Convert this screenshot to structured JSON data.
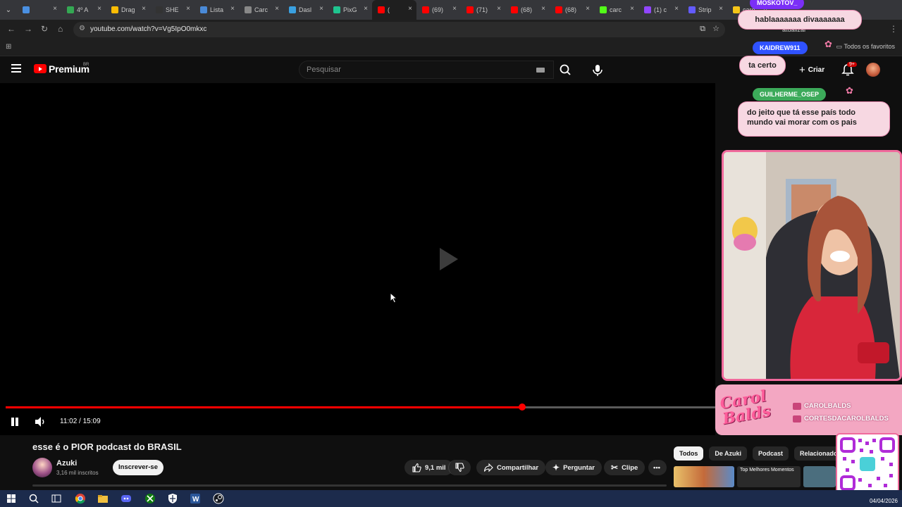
{
  "browser": {
    "tabs": [
      {
        "label": "",
        "color": "#4a90e2"
      },
      {
        "label": "4º A",
        "color": "#34a853"
      },
      {
        "label": "Drag",
        "color": "#fbbc04"
      },
      {
        "label": "SHE",
        "color": "#333333"
      },
      {
        "label": "Lista",
        "color": "#4a8ad8"
      },
      {
        "label": "Carc",
        "color": "#888888"
      },
      {
        "label": "Dasl",
        "color": "#3aa0e0"
      },
      {
        "label": "PixG",
        "color": "#1fc48f"
      },
      {
        "label": "(",
        "color": "#ff0000"
      },
      {
        "label": "(69)",
        "color": "#ff0000"
      },
      {
        "label": "(71)",
        "color": "#ff0000"
      },
      {
        "label": "(68)",
        "color": "#ff0000"
      },
      {
        "label": "(68)",
        "color": "#ff0000"
      },
      {
        "label": "carc",
        "color": "#53fc18"
      },
      {
        "label": "(1) c",
        "color": "#9146ff"
      },
      {
        "label": "Strip",
        "color": "#635bff"
      },
      {
        "label": "caro",
        "color": "#f5c518"
      }
    ],
    "active_tab_index": 8,
    "url": "youtube.com/watch?v=Vg5IpO0mkxc",
    "update_label": "atualizar",
    "bookmarks_all": "Todos os favoritos"
  },
  "youtube": {
    "brand": "Premium",
    "region": "BR",
    "search_placeholder": "Pesquisar",
    "create_label": "Criar",
    "notif_count": "9+",
    "colors": {
      "red": "#ff0000",
      "bg": "#0f0f0f"
    }
  },
  "player": {
    "time": "11:02 / 15:09",
    "progress": 0.728
  },
  "video": {
    "title": "esse é o PIOR podcast do BRASIL",
    "channel": "Azuki",
    "subscribers": "3,16 mil inscritos",
    "subscribe_label": "Inscrever-se",
    "likes": "9,1 mil",
    "share_label": "Compartilhar",
    "ask_label": "Perguntar",
    "clip_label": "Clipe"
  },
  "chips": [
    "Todos",
    "De Azuki",
    "Podcast",
    "Relacionados"
  ],
  "recommended": {
    "thumb_text": "Top Melhores Momentos"
  },
  "stream_overlay": {
    "chat": [
      {
        "user": "MOSKOTOV_",
        "message": "hablaaaaaaa divaaaaaaa",
        "name_color": "#7b2ff7"
      },
      {
        "user": "KAIDREW911",
        "message": "ta certo",
        "name_color": "#2f52ff"
      },
      {
        "user": "GUILHERME_OSEP",
        "message": "do jeito que tá esse país todo mundo vai morar com os pais",
        "name_color": "#3caa5a"
      }
    ],
    "brand_name": "Carol Balds",
    "social_1": "CAROLBALDS",
    "social_2": "CORTESDACAROLBALDS"
  },
  "taskbar": {
    "date": "04/04/2026",
    "apps": [
      "windows-start",
      "search",
      "task-view",
      "chrome",
      "file-explorer",
      "discord",
      "xbox",
      "defender",
      "word",
      "steam"
    ]
  }
}
